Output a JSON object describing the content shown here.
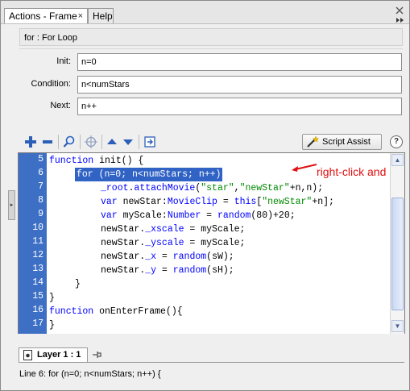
{
  "tabs": {
    "active_label": "Actions - Frame",
    "close_glyph": "×",
    "help_label": "Help"
  },
  "statement": "for : For Loop",
  "fields": [
    {
      "label": "Init:",
      "value": "n=0"
    },
    {
      "label": "Condition:",
      "value": "n<numStars"
    },
    {
      "label": "Next:",
      "value": "n++"
    }
  ],
  "toolbar": {
    "script_assist_label": "Script Assist",
    "help_glyph": "?"
  },
  "editor": {
    "line_numbers": [
      "5",
      "6",
      "7",
      "8",
      "9",
      "10",
      "11",
      "12",
      "13",
      "14",
      "15",
      "16",
      "17"
    ],
    "lines": [
      "function init() {",
      "for (n=0; n<numStars; n++)",
      "_root.attachMovie(\"star\",\"newStar\"+n,n);",
      "var newStar:MovieClip = this[\"newStar\"+n];",
      "var myScale:Number = random(80)+20;",
      "newStar._xscale = myScale;",
      "newStar._yscale = myScale;",
      "newStar._x = random(sW);",
      "newStar._y = random(sH);",
      "}",
      "}",
      "function onEnterFrame(){",
      "}"
    ],
    "annotation": "right-click and Copy"
  },
  "layer_tab_label": "Layer 1 : 1",
  "status_line": "Line 6: for (n=0; n<numStars; n++) {",
  "colors": {
    "gutter": "#3d6fc4",
    "selection": "#3163c5",
    "keyword": "#0000ff",
    "string": "#008a00",
    "annotation": "#e01010"
  }
}
